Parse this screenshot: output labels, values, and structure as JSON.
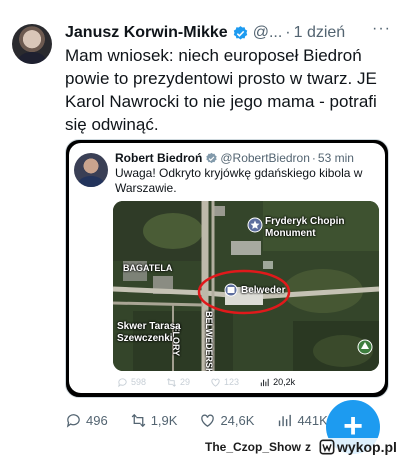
{
  "tweet": {
    "author_name": "Janusz Korwin-Mikke",
    "handle": "@...",
    "separator": "·",
    "time": "1 dzień",
    "more": "···",
    "text": "Mam wniosek: niech europoseł Biedroń powie to prezydentowi prosto w twarz. JE Karol Nawrocki to nie jego mama - potrafi się odwinąć."
  },
  "quoted": {
    "author_name": "Robert Biedroń",
    "handle": "@RobertBiedron",
    "separator": "·",
    "time": "53 min",
    "text": "Uwaga! Odkryto kryjówkę gdańskiego kibola w Warszawie.",
    "map_labels": {
      "chopin": "Fryderyk Chopin\nMonument",
      "bagatela": "BAGATELA",
      "belweder": "Belweder",
      "flory": "FLORY",
      "belwederska": "BELWEDERSKA",
      "skwer": "Skwer Tarasa\nSzewczenki"
    },
    "actions": {
      "replies": "598",
      "reposts": "29",
      "likes": "123",
      "views": "20,2k"
    }
  },
  "actions": {
    "replies": "496",
    "reposts": "1,9K",
    "likes": "24,6K",
    "views": "441K"
  },
  "fab_symbol": "+",
  "watermark": {
    "user": "The_Czop_Show",
    "suffix": "z",
    "site": "wykop.pl"
  },
  "colors": {
    "accent": "#1d9bf0",
    "verified": "#1d9bf0",
    "secondary_text": "#536471",
    "highlight_ring": "#e0191b"
  }
}
